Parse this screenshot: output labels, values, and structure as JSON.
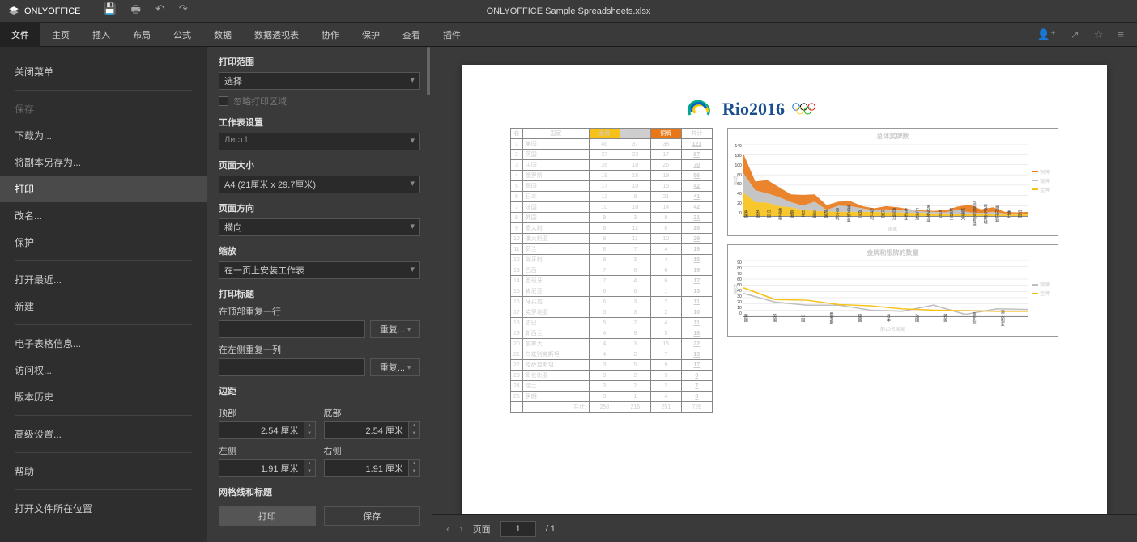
{
  "app": {
    "name": "ONLYOFFICE",
    "docTitle": "ONLYOFFICE Sample Spreadsheets.xlsx"
  },
  "menubar": {
    "tabs": [
      "文件",
      "主页",
      "插入",
      "布局",
      "公式",
      "数据",
      "数据透视表",
      "协作",
      "保护",
      "查看",
      "插件"
    ],
    "active": 0
  },
  "fileMenu": {
    "close": "关闭菜单",
    "save": "保存",
    "downloadAs": "下载为...",
    "saveCopyAs": "将副本另存为...",
    "print": "打印",
    "rename": "改名...",
    "protect": "保护",
    "openRecent": "打开最近...",
    "new": "新建",
    "spreadsheetInfo": "电子表格信息...",
    "accessRights": "访问权...",
    "versionHistory": "版本历史",
    "advancedSettings": "高级设置...",
    "help": "帮助",
    "openFileLocation": "打开文件所在位置"
  },
  "settings": {
    "printRange": {
      "label": "打印范围",
      "value": "选择",
      "ignoreArea": "忽略打印区域"
    },
    "sheetSettings": {
      "label": "工作表设置",
      "value": "Лист1"
    },
    "pageSize": {
      "label": "页面大小",
      "value": "A4 (21厘米 x 29.7厘米)"
    },
    "orientation": {
      "label": "页面方向",
      "value": "横向"
    },
    "scaling": {
      "label": "缩放",
      "value": "在一页上安装工作表"
    },
    "printTitles": {
      "label": "打印标题",
      "repeatRowTop": "在顶部重复一行",
      "repeatColLeft": "在左侧重复一列",
      "repeatBtn": "重复..."
    },
    "margins": {
      "label": "边距",
      "top": "顶部",
      "bottom": "底部",
      "left": "左侧",
      "right": "右侧",
      "topVal": "2.54 厘米",
      "bottomVal": "2.54 厘米",
      "leftVal": "1.91 厘米",
      "rightVal": "1.91 厘米"
    },
    "gridlines": {
      "label": "网格线和标题"
    },
    "printBtn": "打印",
    "saveBtn": "保存"
  },
  "previewNav": {
    "pageLabel": "页面",
    "current": "1",
    "total": "/ 1"
  },
  "spreadsheet": {
    "rioText": "Rio2016",
    "headers": {
      "rank": "名",
      "country": "国家",
      "gold": "金牌",
      "silver": "银牌",
      "bronze": "铜牌",
      "total": "共计"
    },
    "rows": [
      {
        "n": 1,
        "c": "美国",
        "g": 46,
        "s": 37,
        "b": 38,
        "t": 121
      },
      {
        "n": 2,
        "c": "英国",
        "g": 27,
        "s": 23,
        "b": 17,
        "t": 67
      },
      {
        "n": 3,
        "c": "中国",
        "g": 26,
        "s": 18,
        "b": 26,
        "t": 70
      },
      {
        "n": 4,
        "c": "俄罗斯",
        "g": 19,
        "s": 18,
        "b": 19,
        "t": 56
      },
      {
        "n": 5,
        "c": "德国",
        "g": 17,
        "s": 10,
        "b": 15,
        "t": 42
      },
      {
        "n": 6,
        "c": "日本",
        "g": 12,
        "s": 8,
        "b": 21,
        "t": 41
      },
      {
        "n": 7,
        "c": "法国",
        "g": 10,
        "s": 18,
        "b": 14,
        "t": 42
      },
      {
        "n": 8,
        "c": "韩国",
        "g": 9,
        "s": 3,
        "b": 9,
        "t": 21
      },
      {
        "n": 9,
        "c": "意大利",
        "g": 8,
        "s": 12,
        "b": 8,
        "t": 28
      },
      {
        "n": 10,
        "c": "澳大利亚",
        "g": 8,
        "s": 11,
        "b": 10,
        "t": 29
      },
      {
        "n": 11,
        "c": "荷兰",
        "g": 8,
        "s": 7,
        "b": 4,
        "t": 19
      },
      {
        "n": 12,
        "c": "匈牙利",
        "g": 8,
        "s": 3,
        "b": 4,
        "t": 15
      },
      {
        "n": 13,
        "c": "巴西",
        "g": 7,
        "s": 6,
        "b": 6,
        "t": 19
      },
      {
        "n": 14,
        "c": "西班牙",
        "g": 7,
        "s": 4,
        "b": 6,
        "t": 17
      },
      {
        "n": 15,
        "c": "肯尼亚",
        "g": 6,
        "s": 6,
        "b": 1,
        "t": 13
      },
      {
        "n": 16,
        "c": "牙买加",
        "g": 6,
        "s": 3,
        "b": 2,
        "t": 11
      },
      {
        "n": 17,
        "c": "克罗地亚",
        "g": 5,
        "s": 3,
        "b": 2,
        "t": 10
      },
      {
        "n": 18,
        "c": "古巴",
        "g": 5,
        "s": 2,
        "b": 4,
        "t": 11
      },
      {
        "n": 19,
        "c": "新西兰",
        "g": 4,
        "s": 9,
        "b": 5,
        "t": 18
      },
      {
        "n": 20,
        "c": "加拿大",
        "g": 4,
        "s": 3,
        "b": 15,
        "t": 22
      },
      {
        "n": 21,
        "c": "乌兹别克斯坦",
        "g": 4,
        "s": 2,
        "b": 7,
        "t": 13
      },
      {
        "n": 22,
        "c": "哈萨克斯坦",
        "g": 3,
        "s": 5,
        "b": 9,
        "t": 17
      },
      {
        "n": 23,
        "c": "哥伦比亚",
        "g": 3,
        "s": 2,
        "b": 3,
        "t": 8
      },
      {
        "n": 24,
        "c": "瑞士",
        "g": 3,
        "s": 2,
        "b": 2,
        "t": 7
      },
      {
        "n": 25,
        "c": "伊朗",
        "g": 3,
        "s": 1,
        "b": 4,
        "t": 8
      }
    ],
    "totals": {
      "label": "共计:",
      "g": 258,
      "s": 216,
      "b": 251,
      "t": 726
    }
  },
  "chart_data": [
    {
      "type": "area",
      "title": "总体奖牌数",
      "xlabel": "国家",
      "ylabel": "数量",
      "ylim": [
        0,
        140
      ],
      "yticks": [
        0,
        20,
        40,
        60,
        80,
        100,
        120,
        140
      ],
      "categories": [
        "美国",
        "英国",
        "中国",
        "俄罗斯",
        "德国",
        "日本",
        "法国",
        "韩国",
        "意大利",
        "澳大利亚",
        "荷兰",
        "匈牙利",
        "巴西",
        "西班牙",
        "肯尼亚",
        "牙买加",
        "克罗地亚",
        "古巴",
        "新西兰",
        "加拿大",
        "乌兹别克斯坦",
        "哈萨克斯坦",
        "哥伦比亚",
        "瑞士",
        "伊朗"
      ],
      "series": [
        {
          "name": "铜牌",
          "color": "#e87817",
          "values": [
            38,
            17,
            26,
            19,
            15,
            21,
            14,
            9,
            8,
            10,
            4,
            4,
            6,
            6,
            1,
            2,
            2,
            4,
            5,
            15,
            7,
            9,
            3,
            2,
            4
          ]
        },
        {
          "name": "银牌",
          "color": "#bfbfbf",
          "values": [
            37,
            23,
            18,
            18,
            10,
            8,
            18,
            3,
            12,
            11,
            7,
            3,
            6,
            4,
            6,
            3,
            3,
            2,
            9,
            3,
            2,
            5,
            2,
            2,
            1
          ]
        },
        {
          "name": "金牌",
          "color": "#f7c117",
          "values": [
            46,
            27,
            26,
            19,
            17,
            12,
            10,
            9,
            8,
            8,
            8,
            8,
            7,
            7,
            6,
            6,
            5,
            5,
            4,
            4,
            4,
            3,
            3,
            3,
            3
          ]
        }
      ]
    },
    {
      "type": "line",
      "title": "金牌和银牌的数量",
      "xlabel": "前10名国家",
      "ylabel": "数量",
      "ylim": [
        0,
        90
      ],
      "yticks": [
        0,
        10,
        20,
        30,
        40,
        50,
        60,
        70,
        80,
        90
      ],
      "categories": [
        "美国",
        "英国",
        "中国",
        "俄罗斯",
        "德国",
        "日本",
        "法国",
        "韩国",
        "意大利",
        "澳大利亚"
      ],
      "series": [
        {
          "name": "银牌",
          "color": "#bfbfbf",
          "values": [
            37,
            23,
            18,
            18,
            10,
            8,
            18,
            3,
            12,
            11
          ]
        },
        {
          "name": "金牌",
          "color": "#f7c117",
          "values": [
            46,
            27,
            26,
            19,
            17,
            12,
            10,
            9,
            8,
            8
          ]
        }
      ]
    }
  ]
}
